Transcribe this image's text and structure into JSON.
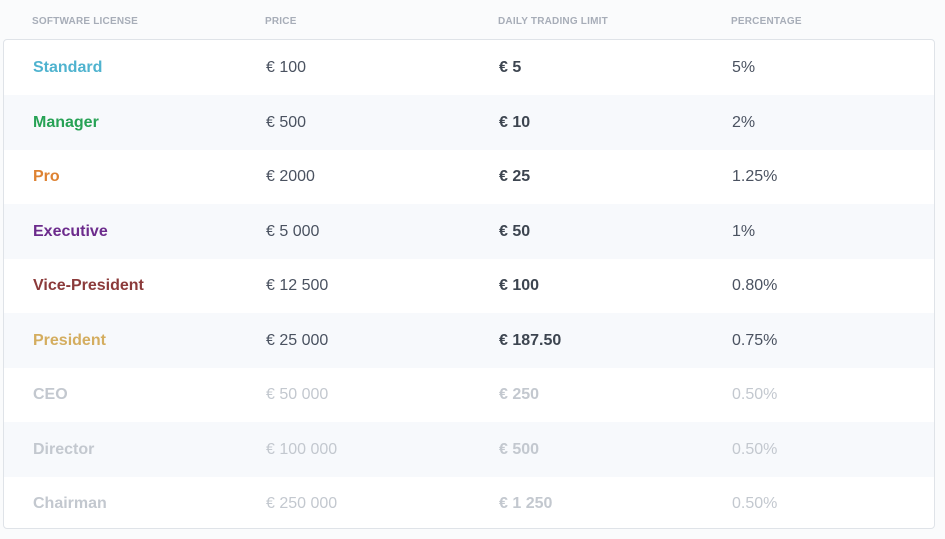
{
  "headers": {
    "license": "SOFTWARE LICENSE",
    "price": "PRICE",
    "limit": "DAILY TRADING LIMIT",
    "percentage": "PERCENTAGE"
  },
  "rows": [
    {
      "name": "Standard",
      "price": "€ 100",
      "limit": "€ 5",
      "percentage": "5%",
      "color": "#4fb3cf",
      "dim": false
    },
    {
      "name": "Manager",
      "price": "€ 500",
      "limit": "€ 10",
      "percentage": "2%",
      "color": "#27a255",
      "dim": false
    },
    {
      "name": "Pro",
      "price": "€ 2000",
      "limit": "€ 25",
      "percentage": "1.25%",
      "color": "#de8232",
      "dim": false
    },
    {
      "name": "Executive",
      "price": "€ 5 000",
      "limit": "€ 50",
      "percentage": "1%",
      "color": "#6c2b8c",
      "dim": false
    },
    {
      "name": "Vice-President",
      "price": "€ 12 500",
      "limit": "€ 100",
      "percentage": "0.80%",
      "color": "#8b3a3a",
      "dim": false
    },
    {
      "name": "President",
      "price": "€ 25 000",
      "limit": "€ 187.50",
      "percentage": "0.75%",
      "color": "#d4ad5f",
      "dim": false
    },
    {
      "name": "CEO",
      "price": "€ 50 000",
      "limit": "€ 250",
      "percentage": "0.50%",
      "color": "#c3c8cf",
      "dim": true
    },
    {
      "name": "Director",
      "price": "€ 100 000",
      "limit": "€ 500",
      "percentage": "0.50%",
      "color": "#c3c8cf",
      "dim": true
    },
    {
      "name": "Chairman",
      "price": "€ 250 000",
      "limit": "€ 1 250",
      "percentage": "0.50%",
      "color": "#c3c8cf",
      "dim": true
    }
  ]
}
